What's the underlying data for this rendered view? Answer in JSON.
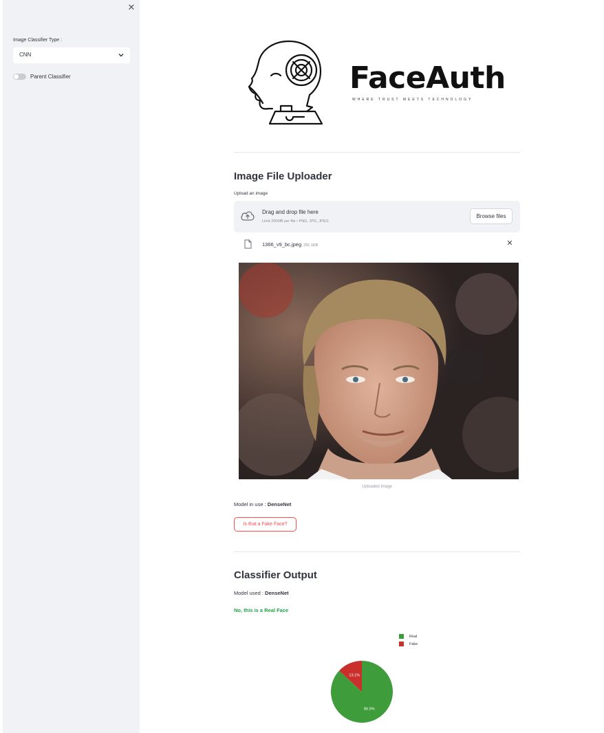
{
  "sidebar": {
    "close_icon": "close-icon",
    "classifier_label": "Image Classifier Type :",
    "classifier_value": "CNN",
    "toggle_label": "Parent Classifier",
    "toggle_on": false
  },
  "logo": {
    "name": "FaceAuth",
    "tagline": "WHERE TRUST MEETS TECHNOLOGY"
  },
  "uploader": {
    "heading": "Image File Uploader",
    "label": "Upload an image",
    "drop_title": "Drag and drop file here",
    "drop_limit": "Limit 200MB per file • PNG, JPG, JPEG",
    "browse_label": "Browse files",
    "file_name": "1366_v9_bc.jpeg",
    "file_size": "291.1KB",
    "image_caption": "Uploaded Image"
  },
  "model": {
    "in_use_label": "Model in use :",
    "in_use_value": "DenseNet",
    "button_label": "Is that a Fake Face?"
  },
  "output": {
    "heading": "Classifier Output",
    "used_label": "Model used :",
    "used_value": "DenseNet",
    "result": "No, this is a Real Face"
  },
  "colors": {
    "accent": "#ff4b4b",
    "real": "#3f9c3a",
    "fake": "#c9302c",
    "result_text": "#21a34a"
  },
  "chart_data": {
    "type": "pie",
    "categories": [
      "Real",
      "Fake"
    ],
    "values": [
      86.9,
      13.1
    ],
    "labels": [
      "86.9%",
      "13.1%"
    ],
    "colors": [
      "#3f9c3a",
      "#c9302c"
    ],
    "legend": "top-right"
  }
}
